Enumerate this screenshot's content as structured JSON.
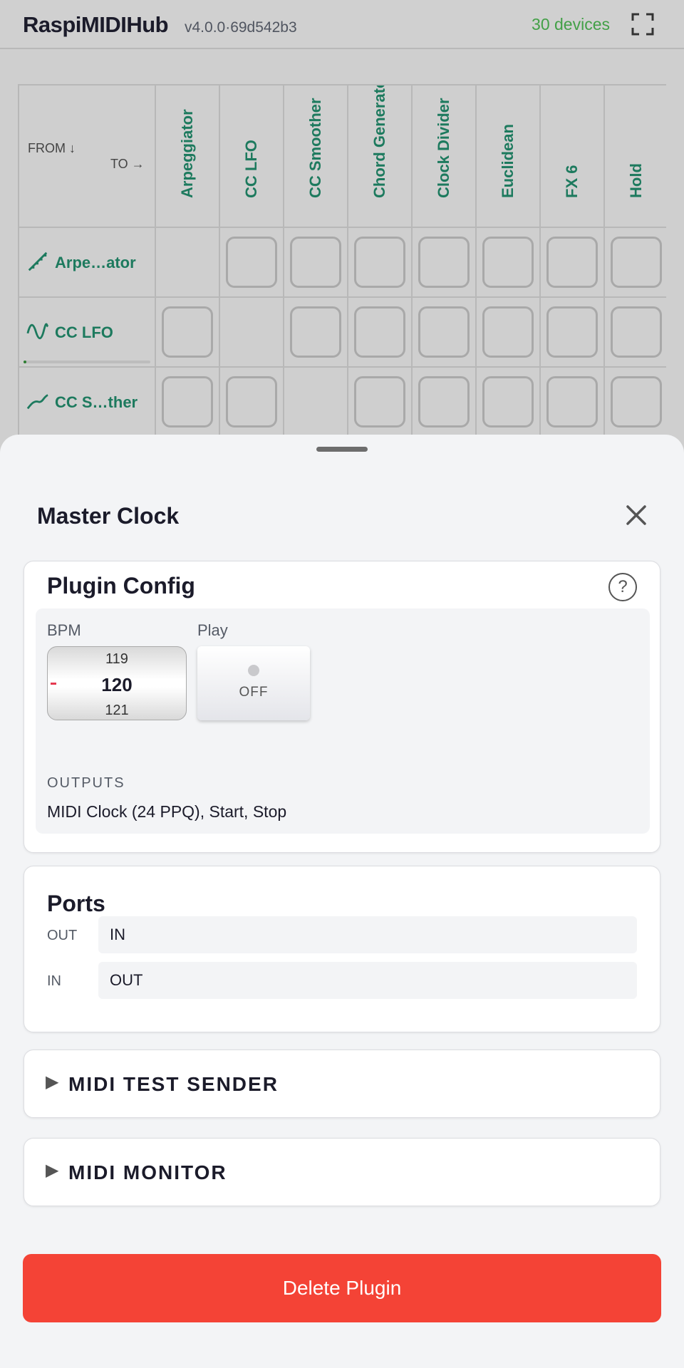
{
  "header": {
    "app_title": "RaspiMIDIHub",
    "version": "v4.0.0·69d542b3",
    "device_count": "30 devices",
    "fullscreen_icon": "fullscreen-icon"
  },
  "matrix": {
    "from_label": "FROM ↓",
    "to_label": "TO →",
    "columns": [
      "Arpeggiator",
      "CC LFO",
      "CC Smoother",
      "Chord Generator",
      "Clock Divider",
      "Euclidean",
      "FX 6",
      "Hold"
    ],
    "rows": [
      {
        "label": "Arpe…ator",
        "icon": "arpeggiator-icon",
        "self_column": 0
      },
      {
        "label": "CC LFO",
        "icon": "lfo-wave-icon",
        "self_column": 1,
        "activity": 0.02
      },
      {
        "label": "CC S…ther",
        "icon": "smoother-curve-icon",
        "self_column": 2
      }
    ]
  },
  "sheet": {
    "title": "Master Clock",
    "close_icon": "close-icon",
    "plugin_config": {
      "title": "Plugin Config",
      "help_label": "?",
      "bpm_label": "BPM",
      "bpm_prev": "119",
      "bpm_current": "120",
      "bpm_next": "121",
      "play_label": "Play",
      "play_state": "OFF",
      "outputs_heading": "OUTPUTS",
      "outputs_value": "MIDI Clock (24 PPQ), Start, Stop"
    },
    "ports": {
      "title": "Ports",
      "out_label": "OUT",
      "out_value": "IN",
      "in_label": "IN",
      "in_value": "OUT"
    },
    "midi_test_sender": {
      "arrow": "▶",
      "title": "MIDI TEST SENDER"
    },
    "midi_monitor": {
      "arrow": "▶",
      "title": "MIDI MONITOR"
    },
    "delete_label": "Delete Plugin"
  },
  "colors": {
    "accent_green": "#1d7a5e",
    "device_count_green": "#43a047",
    "delete_red": "#f44336",
    "bpm_marker": "#e53950"
  }
}
